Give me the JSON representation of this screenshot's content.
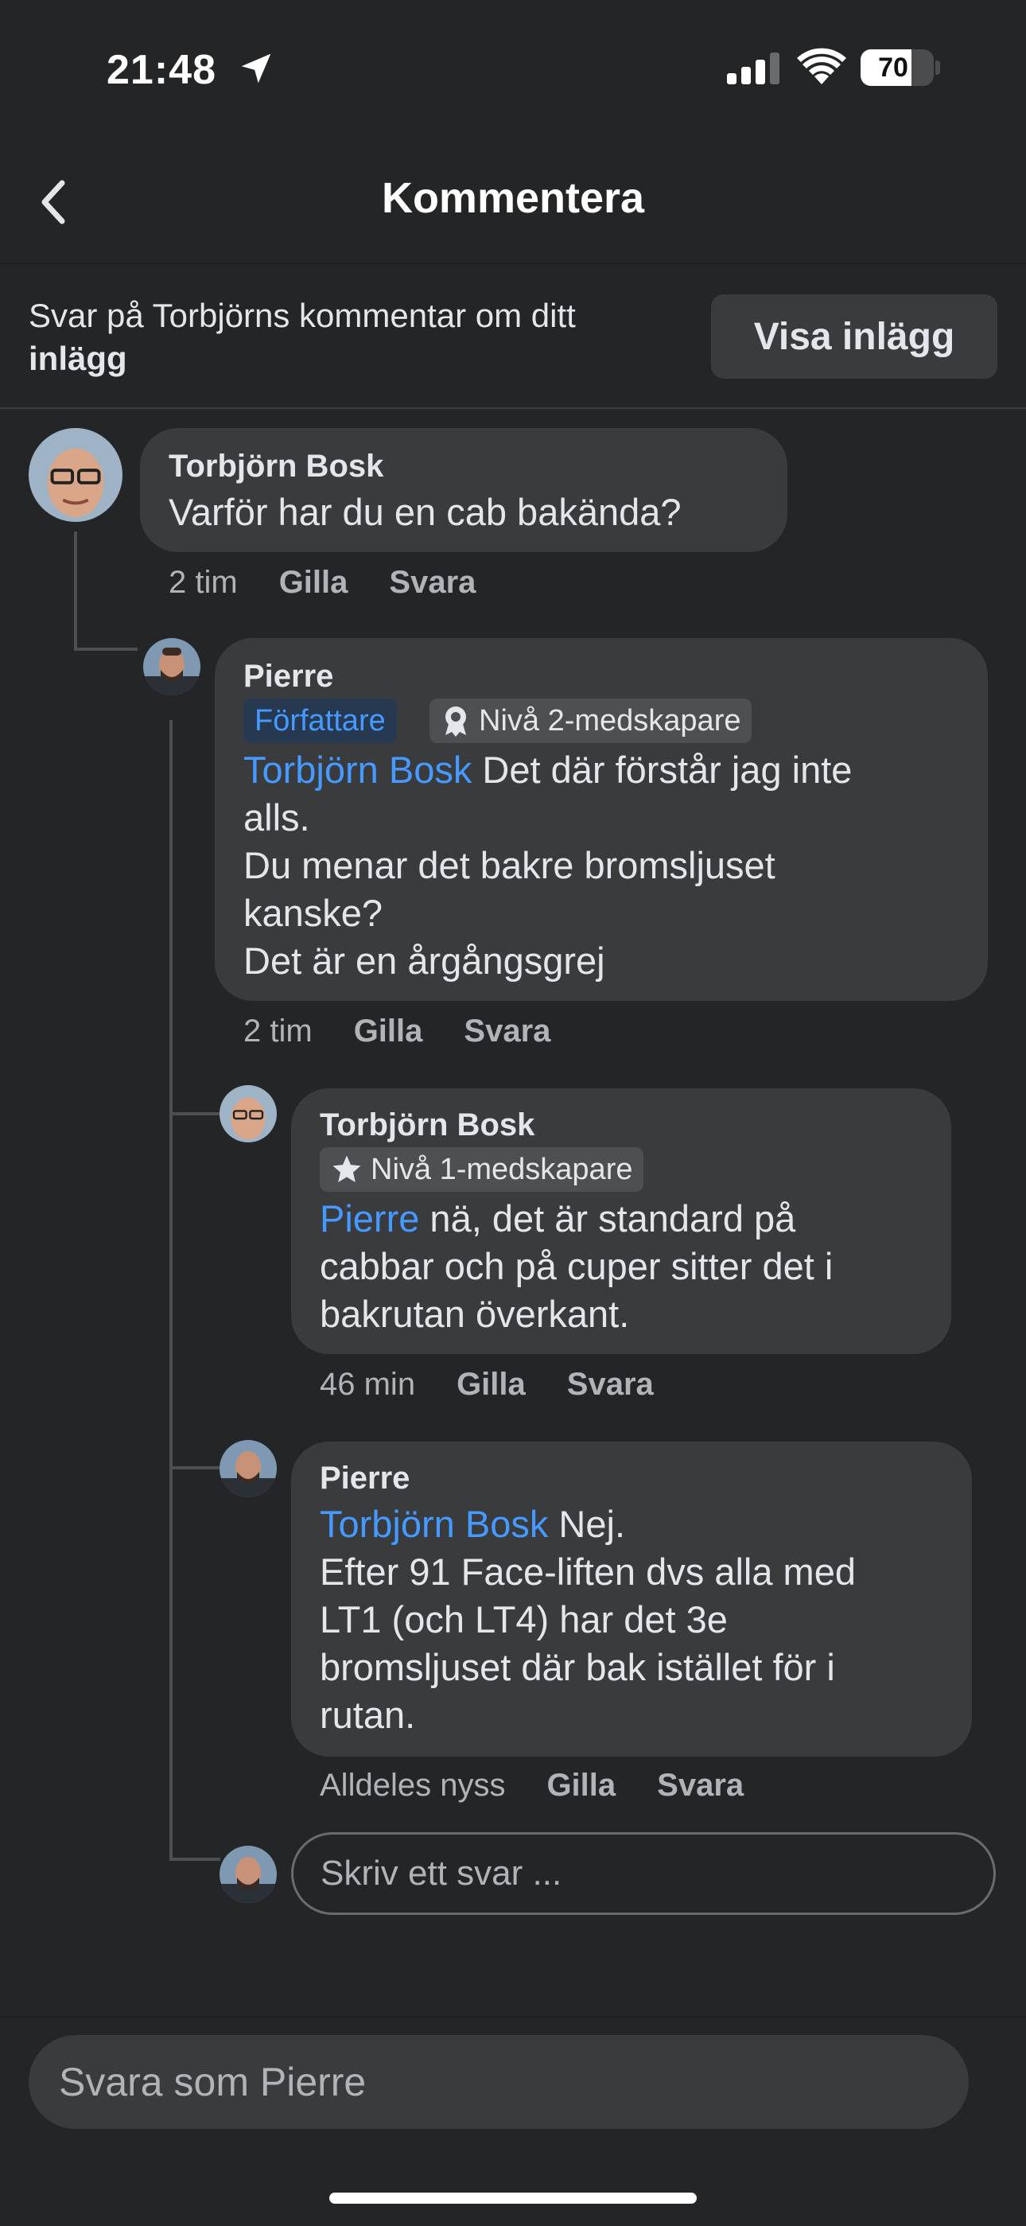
{
  "status_bar": {
    "time": "21:48",
    "battery": "70",
    "battery_level": 0.7
  },
  "header": {
    "title": "Kommentera",
    "back_icon": "chevron-left-icon"
  },
  "context": {
    "text": "Svar på Torbjörns kommentar om ditt",
    "text_bold": "inlägg",
    "button": "Visa inlägg"
  },
  "comments": [
    {
      "author": "Torbjörn Bosk",
      "text": "Varför har du en cab bakända?",
      "time": "2 tim",
      "like": "Gilla",
      "reply": "Svara"
    },
    {
      "author": "Pierre",
      "badge_author": "Författare",
      "badge_rank": "Nivå 2-medskapare",
      "mention": "Torbjörn Bosk",
      "text_lines": [
        " Det där förstår jag inte",
        "alls.",
        "Du menar det bakre bromsljuset",
        "kanske?",
        "Det är en årgångsgrej"
      ],
      "time": "2 tim",
      "like": "Gilla",
      "reply": "Svara"
    },
    {
      "author": "Torbjörn Bosk",
      "badge_rank": "Nivå 1-medskapare",
      "mention": "Pierre",
      "text_lines": [
        " nä, det är standard på",
        "cabbar och på cuper sitter det i",
        "bakrutan överkant."
      ],
      "time": "46 min",
      "like": "Gilla",
      "reply": "Svara"
    },
    {
      "author": "Pierre",
      "mention": "Torbjörn Bosk",
      "text_lines": [
        " Nej.",
        "Efter 91 Face-liften dvs alla med",
        "LT1 (och LT4) har det 3e",
        "bromsljuset där bak istället för i",
        "rutan."
      ],
      "time": "Alldeles nyss",
      "like": "Gilla",
      "reply": "Svara"
    }
  ],
  "reply_input": {
    "placeholder": "Skriv ett svar ..."
  },
  "bottom_input": {
    "placeholder": "Svara som Pierre"
  },
  "colors": {
    "background": "#242526",
    "bubble": "#3a3b3c",
    "mention": "#4599ff",
    "meta": "#b0b3b8"
  }
}
